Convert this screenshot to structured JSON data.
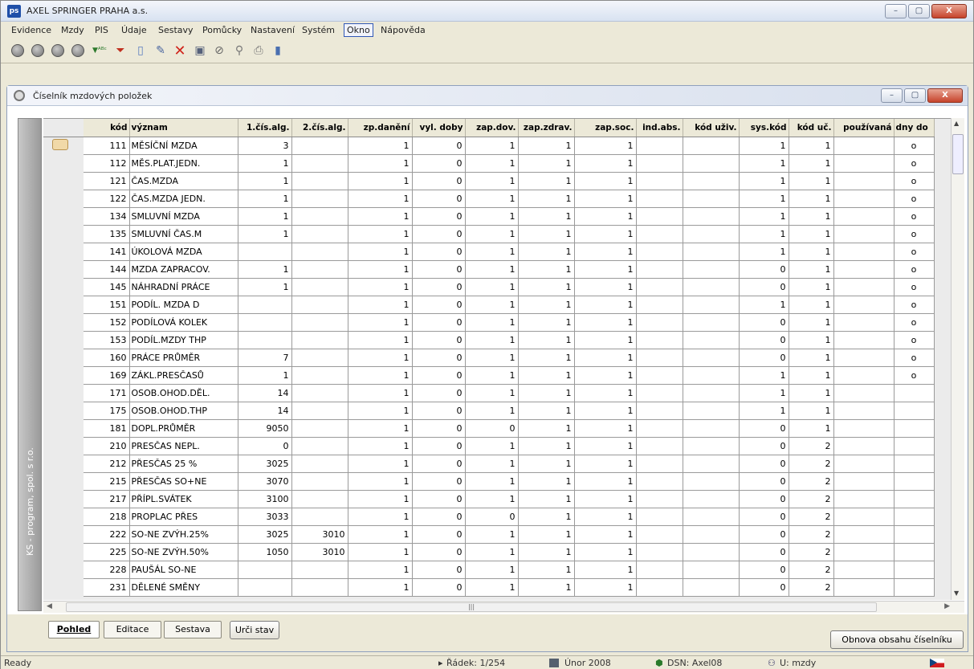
{
  "window": {
    "title": "AXEL SPRINGER PRAHA a.s.",
    "icon": "pis-app-icon",
    "btn_min": "–",
    "btn_max": "▢",
    "btn_close": "X"
  },
  "menu": [
    "Evidence",
    "Mzdy",
    "PIS",
    "Údaje",
    "Sestavy",
    "Pomůcky",
    "Nastavení",
    "Systém",
    "Okno",
    "Nápověda"
  ],
  "menu_active": "Okno",
  "toolbar": [
    "first-record-icon",
    "prev-record-icon",
    "next-record-icon",
    "last-record-icon",
    "filter-abc-icon",
    "filter-icon",
    "new-record-icon",
    "edit-record-icon",
    "delete-icon",
    "save-icon",
    "cancel-icon",
    "search-icon",
    "print-icon",
    "exit-icon"
  ],
  "child": {
    "title": "Číselník mzdových položek"
  },
  "sidestrip": "KS - program, spol. s r.o.",
  "table": {
    "columns": [
      "kód",
      "význam",
      "1.čís.alg.",
      "2.čís.alg.",
      "zp.danění",
      "vyl. doby",
      "zap.dov.",
      "zap.zdrav.",
      "zap.soc.",
      "ind.abs.",
      "kód uživ.",
      "sys.kód",
      "kód uč.",
      "používaná",
      "dny do"
    ],
    "rows": [
      [
        "111",
        "MĚSÍČNÍ MZDA",
        "3",
        "",
        "1",
        "0",
        "1",
        "1",
        "1",
        "",
        "",
        "1",
        "1",
        "",
        "o"
      ],
      [
        "112",
        "MĚS.PLAT.JEDN.",
        "1",
        "",
        "1",
        "0",
        "1",
        "1",
        "1",
        "",
        "",
        "1",
        "1",
        "",
        "o"
      ],
      [
        "121",
        "ČAS.MZDA",
        "1",
        "",
        "1",
        "0",
        "1",
        "1",
        "1",
        "",
        "",
        "1",
        "1",
        "",
        "o"
      ],
      [
        "122",
        "ČAS.MZDA JEDN.",
        "1",
        "",
        "1",
        "0",
        "1",
        "1",
        "1",
        "",
        "",
        "1",
        "1",
        "",
        "o"
      ],
      [
        "134",
        "SMLUVNÍ MZDA",
        "1",
        "",
        "1",
        "0",
        "1",
        "1",
        "1",
        "",
        "",
        "1",
        "1",
        "",
        "o"
      ],
      [
        "135",
        "SMLUVNÍ ČAS.M",
        "1",
        "",
        "1",
        "0",
        "1",
        "1",
        "1",
        "",
        "",
        "1",
        "1",
        "",
        "o"
      ],
      [
        "141",
        "ÚKOLOVÁ MZDA",
        "",
        "",
        "1",
        "0",
        "1",
        "1",
        "1",
        "",
        "",
        "1",
        "1",
        "",
        "o"
      ],
      [
        "144",
        "MZDA ZAPRACOV.",
        "1",
        "",
        "1",
        "0",
        "1",
        "1",
        "1",
        "",
        "",
        "0",
        "1",
        "",
        "o"
      ],
      [
        "145",
        "NÁHRADNÍ PRÁCE",
        "1",
        "",
        "1",
        "0",
        "1",
        "1",
        "1",
        "",
        "",
        "0",
        "1",
        "",
        "o"
      ],
      [
        "151",
        "PODÍL. MZDA D",
        "",
        "",
        "1",
        "0",
        "1",
        "1",
        "1",
        "",
        "",
        "1",
        "1",
        "",
        "o"
      ],
      [
        "152",
        "PODÍLOVÁ KOLEK",
        "",
        "",
        "1",
        "0",
        "1",
        "1",
        "1",
        "",
        "",
        "0",
        "1",
        "",
        "o"
      ],
      [
        "153",
        "PODÍL.MZDY THP",
        "",
        "",
        "1",
        "0",
        "1",
        "1",
        "1",
        "",
        "",
        "0",
        "1",
        "",
        "o"
      ],
      [
        "160",
        "PRÁCE PRŮMĚR",
        "7",
        "",
        "1",
        "0",
        "1",
        "1",
        "1",
        "",
        "",
        "0",
        "1",
        "",
        "o"
      ],
      [
        "169",
        "ZÁKL.PRESČASŮ",
        "1",
        "",
        "1",
        "0",
        "1",
        "1",
        "1",
        "",
        "",
        "1",
        "1",
        "",
        "o"
      ],
      [
        "171",
        "OSOB.OHOD.DĚL.",
        "14",
        "",
        "1",
        "0",
        "1",
        "1",
        "1",
        "",
        "",
        "1",
        "1",
        "",
        ""
      ],
      [
        "175",
        "OSOB.OHOD.THP",
        "14",
        "",
        "1",
        "0",
        "1",
        "1",
        "1",
        "",
        "",
        "1",
        "1",
        "",
        ""
      ],
      [
        "181",
        "DOPL.PRŮMĚR",
        "9050",
        "",
        "1",
        "0",
        "0",
        "1",
        "1",
        "",
        "",
        "0",
        "1",
        "",
        ""
      ],
      [
        "210",
        "PRESČAS NEPL.",
        "0",
        "",
        "1",
        "0",
        "1",
        "1",
        "1",
        "",
        "",
        "0",
        "2",
        "",
        ""
      ],
      [
        "212",
        "PŘESČAS 25 %",
        "3025",
        "",
        "1",
        "0",
        "1",
        "1",
        "1",
        "",
        "",
        "0",
        "2",
        "",
        ""
      ],
      [
        "215",
        "PŘESČAS SO+NE",
        "3070",
        "",
        "1",
        "0",
        "1",
        "1",
        "1",
        "",
        "",
        "0",
        "2",
        "",
        ""
      ],
      [
        "217",
        "PŘÍPL.SVÁTEK",
        "3100",
        "",
        "1",
        "0",
        "1",
        "1",
        "1",
        "",
        "",
        "0",
        "2",
        "",
        ""
      ],
      [
        "218",
        "PROPLAC PŘES",
        "3033",
        "",
        "1",
        "0",
        "0",
        "1",
        "1",
        "",
        "",
        "0",
        "2",
        "",
        ""
      ],
      [
        "222",
        "SO-NE ZVÝH.25%",
        "3025",
        "3010",
        "1",
        "0",
        "1",
        "1",
        "1",
        "",
        "",
        "0",
        "2",
        "",
        ""
      ],
      [
        "225",
        "SO-NE ZVÝH.50%",
        "1050",
        "3010",
        "1",
        "0",
        "1",
        "1",
        "1",
        "",
        "",
        "0",
        "2",
        "",
        ""
      ],
      [
        "228",
        "PAUŠÁL SO-NE",
        "",
        "",
        "1",
        "0",
        "1",
        "1",
        "1",
        "",
        "",
        "0",
        "2",
        "",
        ""
      ],
      [
        "231",
        "DĚLENÉ SMĚNY",
        "",
        "",
        "1",
        "0",
        "1",
        "1",
        "1",
        "",
        "",
        "0",
        "2",
        "",
        ""
      ]
    ]
  },
  "tabs": {
    "pohled": "Pohled",
    "editace": "Editace",
    "sestava": "Sestava"
  },
  "buttons": {
    "urci_stav": "Urči stav",
    "obnova": "Obnova obsahu číselníku"
  },
  "status": {
    "ready": "Ready",
    "radek": "Řádek: 1/254",
    "mesic": "Únor 2008",
    "dsn": "DSN: Axel08",
    "user": "U: mzdy"
  }
}
